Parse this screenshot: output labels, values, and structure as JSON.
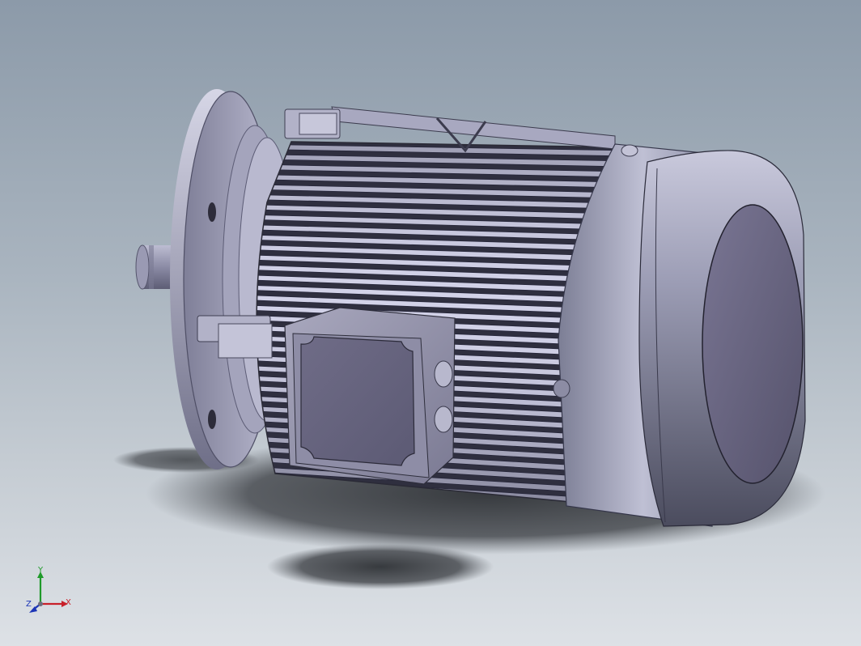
{
  "viewport": {
    "background_top": "#8c9aa9",
    "background_bottom": "#dde1e6"
  },
  "model": {
    "body_color": "#9c9db5",
    "shadow_color": "#3a3d42"
  },
  "triad": {
    "x_label": "X",
    "y_label": "Y",
    "z_label": "Z",
    "x_color": "#c8202a",
    "y_color": "#1f9a2a",
    "z_color": "#1c35b6"
  }
}
